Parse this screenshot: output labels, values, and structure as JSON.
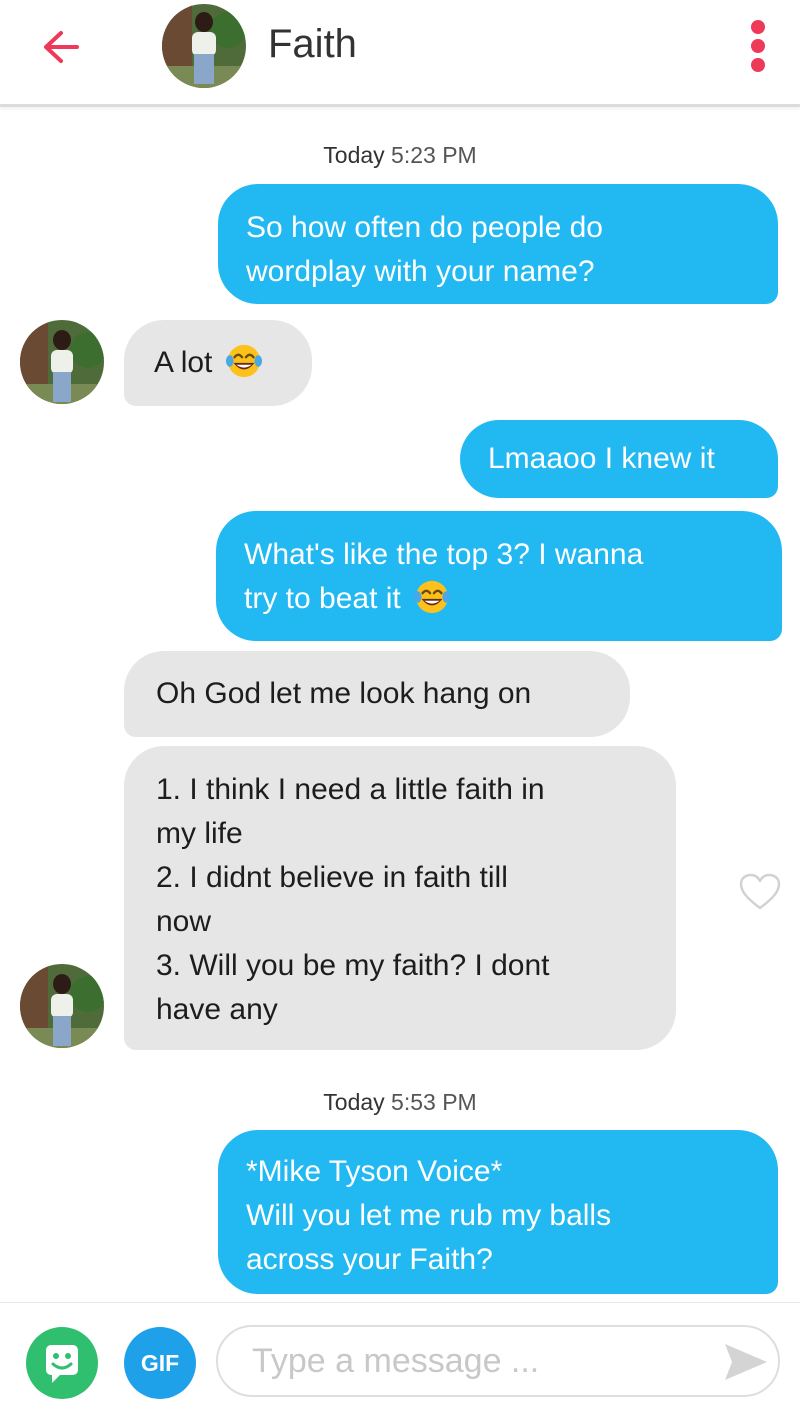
{
  "header": {
    "name": "Faith",
    "accent_color": "#ee3a58",
    "icons": {
      "back": "arrow-left-icon",
      "more": "more-vertical-icon"
    }
  },
  "conversation": {
    "timestamps": [
      {
        "day": "Today",
        "time": "5:23 PM"
      },
      {
        "day": "Today",
        "time": "5:53 PM"
      }
    ],
    "messages": [
      {
        "direction": "outgoing",
        "lines": [
          "So how often do people do",
          "wordplay with your name?"
        ]
      },
      {
        "direction": "incoming",
        "lines": [
          "A lot"
        ],
        "emoji": "tears-of-joy-emoji"
      },
      {
        "direction": "outgoing",
        "lines": [
          "Lmaaoo I knew it"
        ]
      },
      {
        "direction": "outgoing",
        "lines": [
          "What's like the top 3? I wanna",
          "try to beat it"
        ],
        "emoji": "tears-of-joy-emoji"
      },
      {
        "direction": "incoming",
        "lines": [
          "Oh God let me look hang on"
        ]
      },
      {
        "direction": "incoming",
        "lines": [
          "1. I think I need a little faith in",
          "my life",
          "2. I didnt believe in faith till",
          "now",
          "3. Will you be my faith? I dont",
          "have any"
        ],
        "reaction_icon": "heart-outline-icon"
      },
      {
        "direction": "outgoing",
        "lines": [
          "*Mike Tyson Voice*",
          "Will you let me rub my balls",
          "across your Faith?"
        ]
      }
    ],
    "colors": {
      "outgoing_bubble": "#22b9f2",
      "incoming_bubble": "#e6e6e6"
    }
  },
  "composer": {
    "gif_label": "GIF",
    "placeholder": "Type a message ...",
    "value": "",
    "icons": {
      "gift": "gift-icon",
      "send": "send-icon"
    },
    "colors": {
      "gift": "#2fbf6f",
      "gif": "#1fa1ea"
    }
  }
}
